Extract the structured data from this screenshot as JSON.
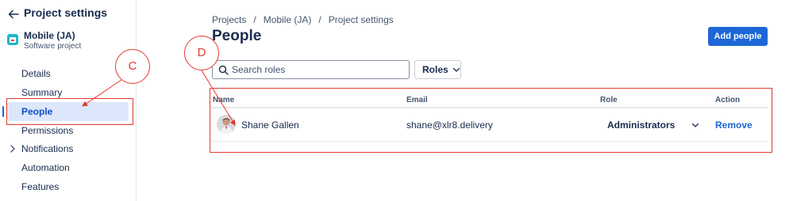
{
  "sidebar": {
    "title": "Project settings",
    "project_name": "Mobile (JA)",
    "project_type": "Software project",
    "items": [
      {
        "label": "Details"
      },
      {
        "label": "Summary"
      },
      {
        "label": "People"
      },
      {
        "label": "Permissions"
      },
      {
        "label": "Notifications"
      },
      {
        "label": "Automation"
      },
      {
        "label": "Features"
      }
    ],
    "active_item": "People"
  },
  "breadcrumb": [
    "Projects",
    "/",
    "Mobile (JA)",
    "/",
    "Project settings"
  ],
  "page_title": "People",
  "add_button": "Add people",
  "search": {
    "placeholder": "Search roles",
    "value": ""
  },
  "roles_filter": "Roles",
  "table": {
    "headers": [
      "Name",
      "Email",
      "Role",
      "Action"
    ],
    "rows": [
      {
        "name": "Shane Gallen",
        "email": "shane@xlr8.delivery",
        "role": "Administrators",
        "action": "Remove"
      }
    ]
  },
  "annotations": [
    "C",
    "D"
  ],
  "colors": {
    "accent": "#1d66d6",
    "annotation": "#e23a2b",
    "active_bg": "#dde7fb"
  }
}
